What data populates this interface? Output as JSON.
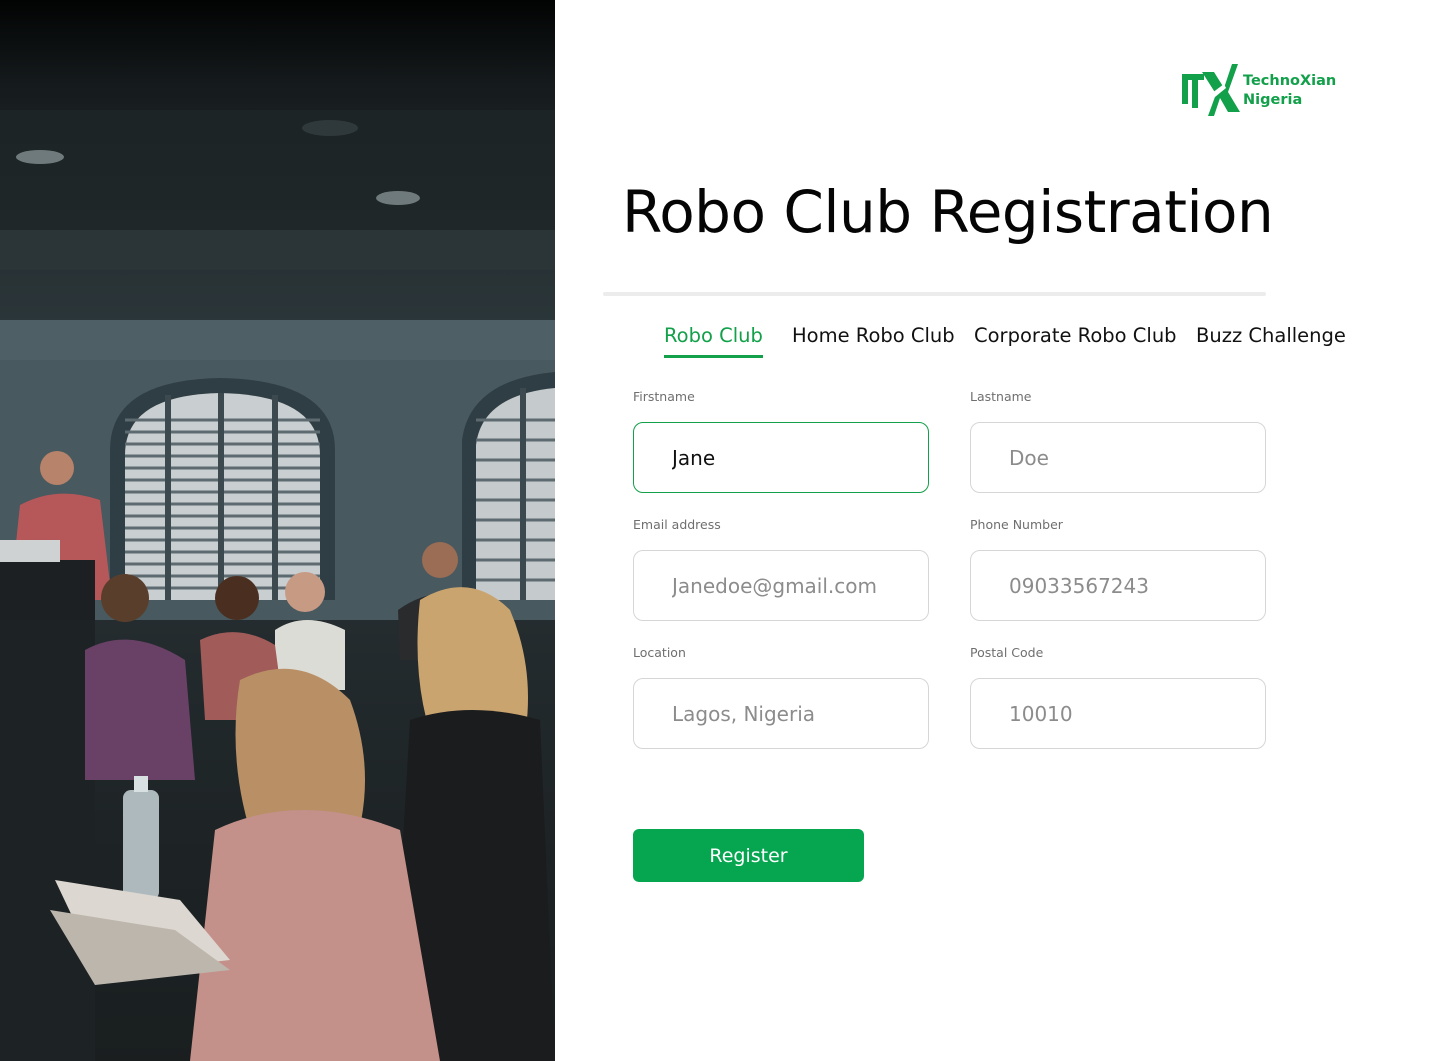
{
  "brand": {
    "logo_mark": "TX",
    "name_line1": "TechnoXian",
    "name_line2": "Nigeria",
    "accent_color": "#12a04a"
  },
  "page": {
    "title": "Robo Club Registration"
  },
  "tabs": [
    {
      "label": "Robo Club",
      "active": true
    },
    {
      "label": "Home Robo Club",
      "active": false
    },
    {
      "label": "Corporate Robo Club",
      "active": false
    },
    {
      "label": "Buzz Challenge",
      "active": false
    }
  ],
  "form": {
    "firstname": {
      "label": "Firstname",
      "value": "Jane"
    },
    "lastname": {
      "label": "Lastname",
      "placeholder": "Doe"
    },
    "email": {
      "label": "Email address",
      "placeholder": "Janedoe@gmail.com"
    },
    "phone": {
      "label": "Phone Number",
      "placeholder": "09033567243"
    },
    "location": {
      "label": "Location",
      "placeholder": "Lagos, Nigeria"
    },
    "postal": {
      "label": "Postal Code",
      "placeholder": "10010"
    },
    "submit_label": "Register",
    "submit_color": "#06a650"
  },
  "photo": {
    "icon": "classroom-photo"
  }
}
